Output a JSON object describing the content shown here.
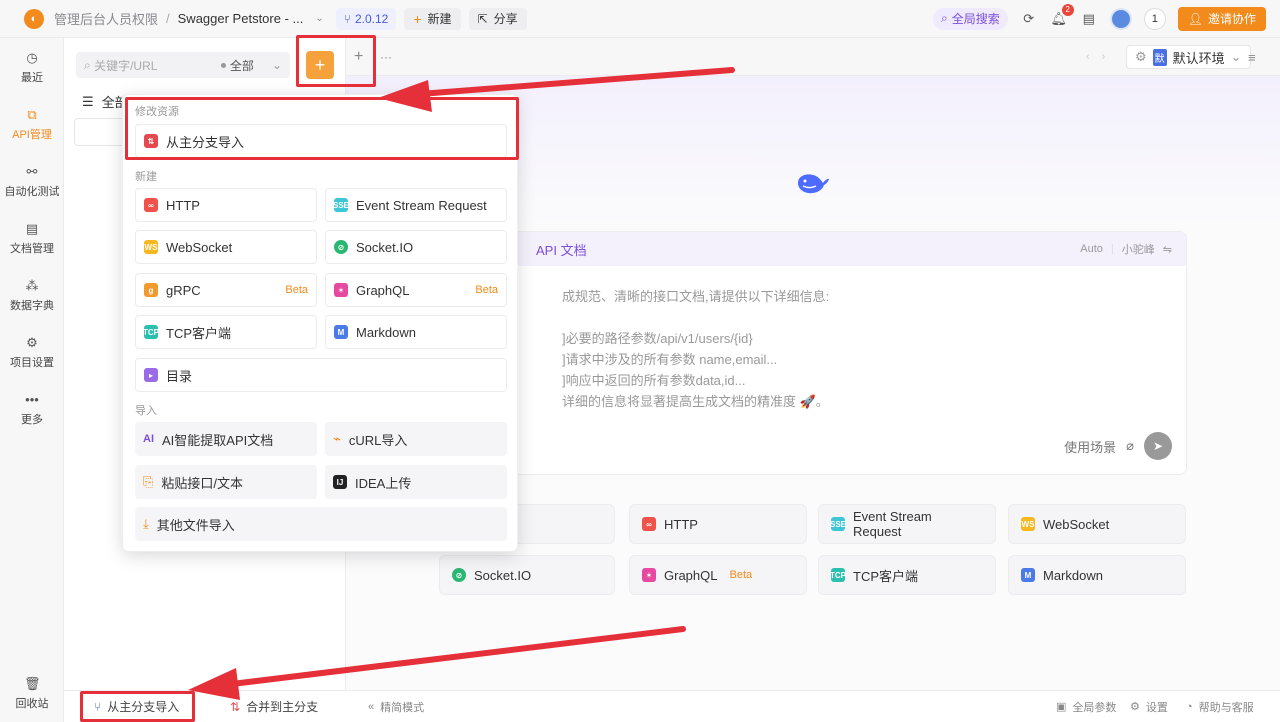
{
  "topbar": {
    "crumb_parent": "管理后台人员权限",
    "crumb_separator": "/",
    "crumb_current": "Swagger Petstore - ...",
    "version": "2.0.12",
    "new_label": "新建",
    "share_label": "分享",
    "global_search": "全局搜索",
    "notification_count": "2",
    "online_count": "1",
    "invite_label": "邀请协作"
  },
  "leftnav": {
    "items": [
      {
        "label": "最近",
        "icon": "clock-icon"
      },
      {
        "label": "API管理",
        "icon": "api-icon",
        "active": true
      },
      {
        "label": "自动化测试",
        "icon": "automation-icon"
      },
      {
        "label": "文档管理",
        "icon": "document-icon"
      },
      {
        "label": "数据字典",
        "icon": "dictionary-icon"
      },
      {
        "label": "项目设置",
        "icon": "settings-icon"
      },
      {
        "label": "更多",
        "icon": "more-icon"
      }
    ],
    "trash": "回收站"
  },
  "sidepanel": {
    "search_placeholder": "关键字/URL",
    "filter": "全部",
    "tree_root": "全部"
  },
  "tabbar": {
    "env": "默认环境",
    "env_tag": "默"
  },
  "dropdown": {
    "section_modify": "修改资源",
    "import_from_main": "从主分支导入",
    "section_new": "新建",
    "new_items": [
      {
        "label": "HTTP",
        "color": "#f0524a",
        "icon": "link-icon"
      },
      {
        "label": "Event Stream Request",
        "color": "#3ec6d6",
        "icon": "sse-icon",
        "icon_text": "SSE"
      },
      {
        "label": "WebSocket",
        "color": "#f5b820",
        "icon": "ws-icon",
        "icon_text": "WS"
      },
      {
        "label": "Socket.IO",
        "color": "#2bb673",
        "icon": "socketio-icon"
      },
      {
        "label": "gRPC",
        "color": "#f29a2e",
        "icon": "grpc-icon",
        "beta": "Beta"
      },
      {
        "label": "GraphQL",
        "color": "#e64aa0",
        "icon": "graphql-icon",
        "beta": "Beta"
      },
      {
        "label": "TCP客户端",
        "color": "#2bbfb0",
        "icon": "tcp-icon",
        "icon_text": "TCP"
      },
      {
        "label": "Markdown",
        "color": "#4a7be8",
        "icon": "markdown-icon",
        "icon_text": "M"
      },
      {
        "label": "目录",
        "color": "#9b6ae6",
        "icon": "folder-icon"
      }
    ],
    "section_import": "导入",
    "import_items": [
      {
        "label": "AI智能提取API文档",
        "icon": "ai-icon"
      },
      {
        "label": "cURL导入",
        "icon": "curl-icon"
      },
      {
        "label": "粘贴接口/文本",
        "icon": "paste-icon"
      },
      {
        "label": "IDEA上传",
        "icon": "idea-icon"
      },
      {
        "label": "其他文件导入",
        "icon": "file-import-icon"
      }
    ]
  },
  "main": {
    "ai_title": "API 文档",
    "ai_mode": "Auto",
    "ai_model": "小驼峰",
    "ai_lines": [
      "成规范、清晰的接口文档,请提供以下详细信息:",
      "",
      "]必要的路径参数/api/v1/users/{id}",
      "]请求中涉及的所有参数 name,email...",
      "]响应中返回的所有参数data,id...",
      "详细的信息将显著提高生成文档的精准度 🚀。"
    ],
    "use_case": "使用场景",
    "quick_items": [
      {
        "label": "]",
        "color": "#9b6ae6"
      },
      {
        "label": "HTTP",
        "color": "#f0524a",
        "icon_text": ""
      },
      {
        "label": "Event Stream Request",
        "color": "#3ec6d6",
        "icon_text": "SSE"
      },
      {
        "label": "WebSocket",
        "color": "#f5b820",
        "icon_text": "WS"
      },
      {
        "label": "Socket.IO",
        "color": "#2bb673",
        "icon_text": ""
      },
      {
        "label": "GraphQL",
        "color": "#e64aa0",
        "icon_text": "",
        "beta": "Beta"
      },
      {
        "label": "TCP客户端",
        "color": "#2bbfb0",
        "icon_text": "TCP"
      },
      {
        "label": "Markdown",
        "color": "#4a7be8",
        "icon_text": "M"
      }
    ]
  },
  "bottombar": {
    "import_from_main": "从主分支导入",
    "merge_to_main": "合并到主分支",
    "simple_mode": "精简模式",
    "global_params": "全局参数",
    "settings": "设置",
    "help": "帮助与客服"
  }
}
